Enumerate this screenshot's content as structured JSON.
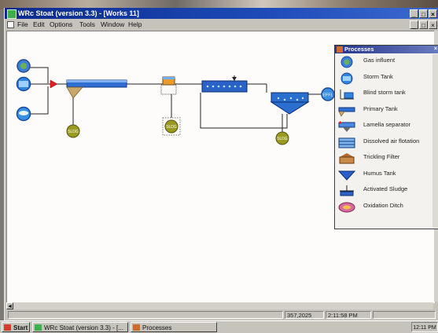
{
  "app": {
    "title": "WRc Stoat (version 3.3) - [Works 11]",
    "colors": {
      "titlebar": "#1d4bb8",
      "sludge": "#9a9a20",
      "tank_blue": "#2e6fd0",
      "arrow_red": "#e02020",
      "canvas": "#fdfcfa"
    }
  },
  "window_buttons": {
    "minimize": "_",
    "maximize": "□",
    "close": "×"
  },
  "mdi_buttons": {
    "minimize": "_",
    "restore": "□",
    "close": "×"
  },
  "menu": {
    "items": [
      "File",
      "Edit",
      "Options",
      "Tools",
      "Window",
      "Help"
    ]
  },
  "flowsheet": {
    "sludge_label": "SLDG",
    "effluent_label": "EFFL",
    "units": [
      {
        "name": "gas-influent",
        "kind": "influent"
      },
      {
        "name": "storm-tank",
        "kind": "influent"
      },
      {
        "name": "blind-storm-tank",
        "kind": "influent"
      },
      {
        "name": "primary-tank",
        "kind": "primary"
      },
      {
        "name": "trickling-filter",
        "kind": "tank"
      },
      {
        "name": "activated-sludge",
        "kind": "aeration"
      },
      {
        "name": "final-settler",
        "kind": "settler"
      },
      {
        "name": "effluent",
        "kind": "outlet"
      }
    ]
  },
  "palette": {
    "title": "Processes",
    "close": "×",
    "items": [
      {
        "label": "Gas influent",
        "icon": "gas-influent-icon"
      },
      {
        "label": "Storm Tank",
        "icon": "storm-tank-icon"
      },
      {
        "label": "Blind storm tank",
        "icon": "blind-storm-tank-icon"
      },
      {
        "label": "Primary Tank",
        "icon": "primary-tank-icon"
      },
      {
        "label": "Lamella separator",
        "icon": "lamella-separator-icon"
      },
      {
        "label": "Dissolved air flotation",
        "icon": "dissolved-air-flotation-icon"
      },
      {
        "label": "Trickling Filter",
        "icon": "trickling-filter-icon"
      },
      {
        "label": "Humus Tank",
        "icon": "humus-tank-icon"
      },
      {
        "label": "Activated Sludge",
        "icon": "activated-sludge-icon"
      },
      {
        "label": "Oxidation Ditch",
        "icon": "oxidation-ditch-icon"
      }
    ]
  },
  "status": {
    "coordinates": "357,2025",
    "time": "2:11:58 PM"
  },
  "scroll": {
    "left_arrow": "◄"
  },
  "taskbar": {
    "start": "Start",
    "tasks": [
      "WRc Stoat (version 3.3) - [...",
      "Processes"
    ],
    "clock": "12:11 PM"
  }
}
